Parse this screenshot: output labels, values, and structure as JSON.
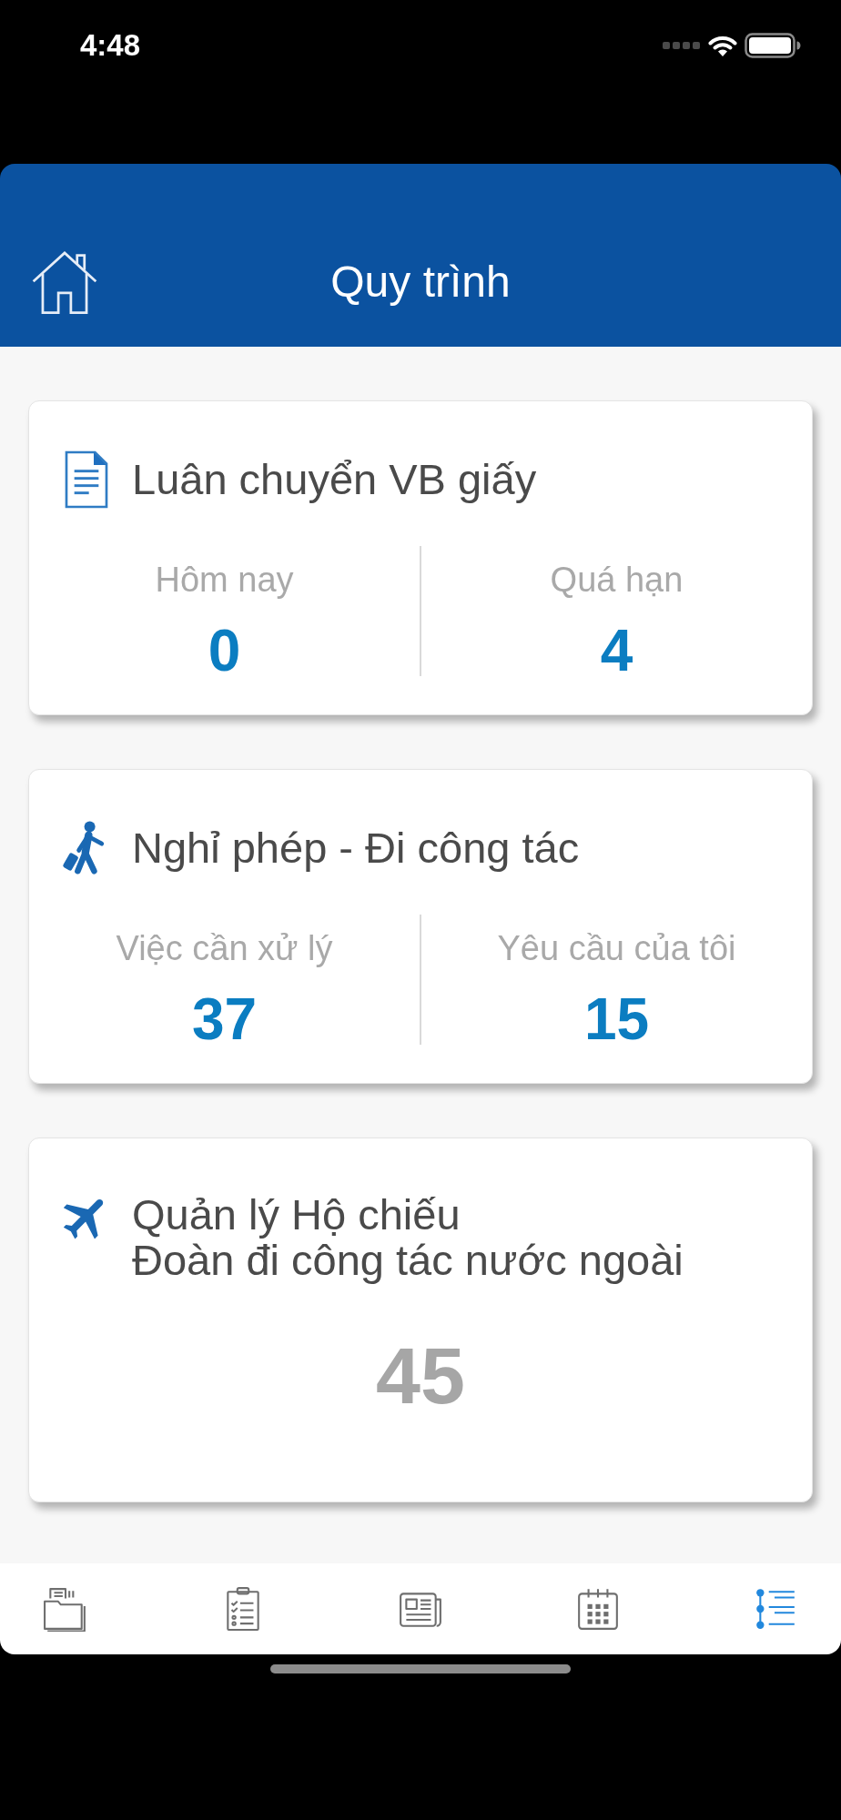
{
  "status_bar": {
    "time": "4:48"
  },
  "header": {
    "title": "Quy trình"
  },
  "cards": [
    {
      "kind": "split",
      "title_lines": [
        "Luân chuyển VB giấy"
      ],
      "stats": [
        {
          "label": "Hôm nay",
          "value": "0"
        },
        {
          "label": "Quá hạn",
          "value": "4"
        }
      ]
    },
    {
      "kind": "split",
      "title_lines": [
        "Nghỉ phép - Đi công tác"
      ],
      "stats": [
        {
          "label": "Việc cần xử lý",
          "value": "37"
        },
        {
          "label": "Yêu cầu của tôi",
          "value": "15"
        }
      ]
    },
    {
      "kind": "single",
      "title_lines": [
        "Quản lý Hộ chiếu",
        "Đoàn đi công tác nước ngoài"
      ],
      "value": "45"
    }
  ],
  "tab_bar": {
    "tabs": [
      {
        "selected": false
      },
      {
        "selected": false
      },
      {
        "selected": false
      },
      {
        "selected": false
      },
      {
        "selected": true
      }
    ]
  }
}
